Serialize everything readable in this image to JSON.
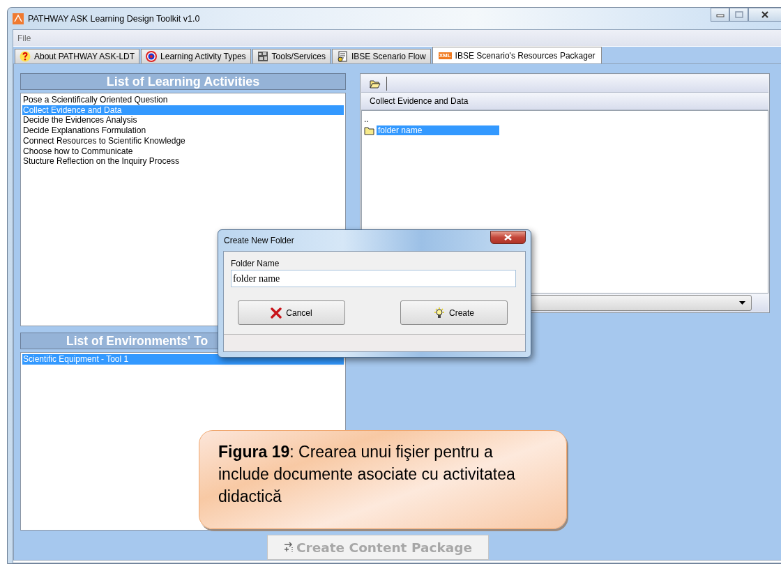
{
  "window": {
    "title": "PATHWAY ASK Learning Design Toolkit v1.0"
  },
  "menu": [
    {
      "label": "File"
    }
  ],
  "tabs": [
    {
      "label": "About PATHWAY ASK-LDT",
      "kind": "help",
      "selected": false
    },
    {
      "label": "Learning Activity Types",
      "kind": "target",
      "selected": false
    },
    {
      "label": "Tools/Services",
      "kind": "tools",
      "selected": false
    },
    {
      "label": "IBSE Scenario Flow",
      "kind": "flow",
      "selected": false
    },
    {
      "label": "IBSE Scenario's Resources Packager",
      "kind": "xml",
      "badge": "XML",
      "selected": true
    }
  ],
  "activities": {
    "title": "List of Learning Activities",
    "items": [
      {
        "label": "Pose a Scientifically Oriented Question",
        "selected": false
      },
      {
        "label": "Collect Evidence and Data",
        "selected": true
      },
      {
        "label": "Decide the Evidences Analysis",
        "selected": false
      },
      {
        "label": "Decide Explanations Formulation",
        "selected": false
      },
      {
        "label": "Connect Resources to Scientific Knowledge",
        "selected": false
      },
      {
        "label": "Choose how to Communicate",
        "selected": false
      },
      {
        "label": "Stucture Reflection on the Inquiry Process",
        "selected": false
      }
    ]
  },
  "tools": {
    "title": "List of Environments' To",
    "items": [
      {
        "label": "Scientific Equipment - Tool 1",
        "selected": true
      }
    ]
  },
  "browser": {
    "path": "Collect Evidence and Data",
    "entries": [
      {
        "label": "..",
        "kind": "parent",
        "selected": false
      },
      {
        "label": "folder name",
        "kind": "folder",
        "selected": true
      }
    ]
  },
  "package_button": {
    "label": "Create Content Package",
    "disabled": true
  },
  "dialog": {
    "title": "Create New Folder",
    "field_label": "Folder Name",
    "value": "folder name",
    "buttons": [
      {
        "label": "Cancel",
        "kind": "cancel"
      },
      {
        "label": "Create",
        "kind": "create"
      }
    ]
  },
  "caption": "**Figura 19**: Crearea unui fişier pentru a include documente asociate cu activitatea didactică"
}
